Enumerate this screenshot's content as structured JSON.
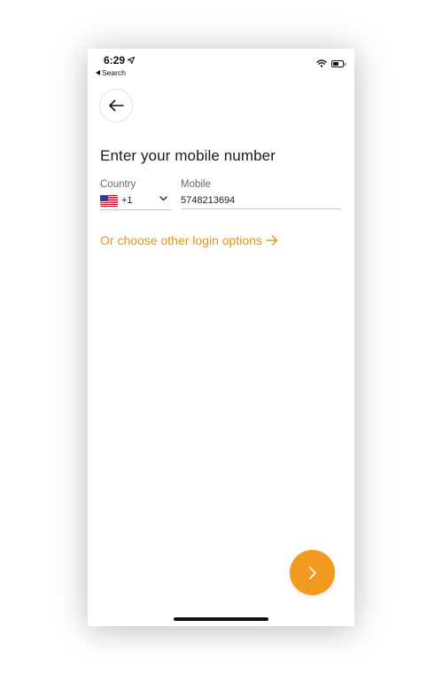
{
  "status_bar": {
    "time": "6:29",
    "back_app": "Search",
    "icons": [
      "location-arrow-icon",
      "wifi-icon",
      "battery-icon"
    ],
    "battery_level": 0.6
  },
  "nav": {
    "back_icon": "arrow-left-icon"
  },
  "form": {
    "title": "Enter your mobile number",
    "country_label": "Country",
    "country_flag": "us-flag-icon",
    "country_code": "+1",
    "mobile_label": "Mobile",
    "mobile_value": "5748213694"
  },
  "other_login": {
    "label": "Or choose other login options",
    "icon": "arrow-right-icon"
  },
  "next_button": {
    "icon": "chevron-right-icon"
  },
  "colors": {
    "accent": "#f29a1f",
    "link": "#e8930f",
    "text": "#1a1a1a",
    "muted": "#666666",
    "divider": "#c9c9c9"
  }
}
